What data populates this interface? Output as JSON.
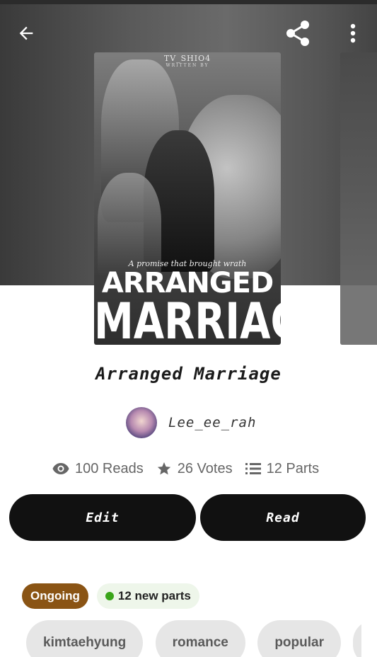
{
  "header": {
    "back_icon": "arrow-left-icon",
    "share_icon": "share-icon",
    "more_icon": "more-vertical-icon"
  },
  "cover": {
    "author_text": "TV_SHIO4",
    "written_by": "WRITTEN BY",
    "tagline": "A promise that brought wrath",
    "title_line1": "ARRANGED",
    "title_line2": "MARRIAGE"
  },
  "story": {
    "title": "Arranged Marriage",
    "author": "Lee_ee_rah"
  },
  "stats": {
    "reads": "100 Reads",
    "votes": "26 Votes",
    "parts": "12 Parts"
  },
  "actions": {
    "edit_label": "Edit",
    "read_label": "Read"
  },
  "status": {
    "ongoing_label": "Ongoing",
    "new_parts_label": "12 new parts",
    "ongoing_color": "#8a5414",
    "new_dot_color": "#3aa51a"
  },
  "tags": [
    "kimtaehyung",
    "romance",
    "popular"
  ]
}
